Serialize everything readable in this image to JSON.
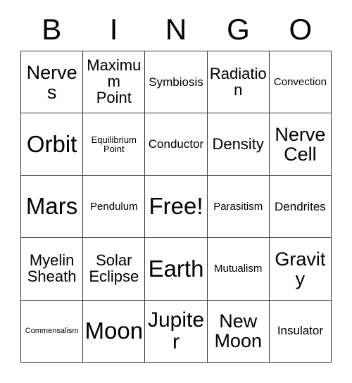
{
  "card": {
    "header_letters": [
      "B",
      "I",
      "N",
      "G",
      "O"
    ],
    "columns": 5,
    "rows": 5,
    "free_space_label": "Free!",
    "border_color": "#3a3a3a",
    "background_color": "#ffffff",
    "text_color": "#000000",
    "cells": [
      [
        {
          "text": "Nerves",
          "size": "fs-lg"
        },
        {
          "text": "Maximum\nPoint",
          "size": "fs-md"
        },
        {
          "text": "Symbiosis",
          "size": "fs-sm"
        },
        {
          "text": "Radiation",
          "size": "fs-md"
        },
        {
          "text": "Convection",
          "size": "fs-xs"
        }
      ],
      [
        {
          "text": "Orbit",
          "size": "fs-xxl"
        },
        {
          "text": "Equilibrium\nPoint",
          "size": "fs-xxs"
        },
        {
          "text": "Conductor",
          "size": "fs-sm"
        },
        {
          "text": "Density",
          "size": "fs-md"
        },
        {
          "text": "Nerve\nCell",
          "size": "fs-lg"
        }
      ],
      [
        {
          "text": "Mars",
          "size": "fs-xxl"
        },
        {
          "text": "Pendulum",
          "size": "fs-xs"
        },
        {
          "text": "Free!",
          "size": "fs-xxl"
        },
        {
          "text": "Parasitism",
          "size": "fs-xs"
        },
        {
          "text": "Dendrites",
          "size": "fs-sm"
        }
      ],
      [
        {
          "text": "Myelin\nSheath",
          "size": "fs-md"
        },
        {
          "text": "Solar\nEclipse",
          "size": "fs-md"
        },
        {
          "text": "Earth",
          "size": "fs-xxl"
        },
        {
          "text": "Mutualism",
          "size": "fs-xs"
        },
        {
          "text": "Gravity",
          "size": "fs-lg"
        }
      ],
      [
        {
          "text": "Commensalism",
          "size": "fs-tiny"
        },
        {
          "text": "Moon",
          "size": "fs-xxl"
        },
        {
          "text": "Jupiter",
          "size": "fs-xl"
        },
        {
          "text": "New\nMoon",
          "size": "fs-lg"
        },
        {
          "text": "Insulator",
          "size": "fs-sm"
        }
      ]
    ]
  }
}
